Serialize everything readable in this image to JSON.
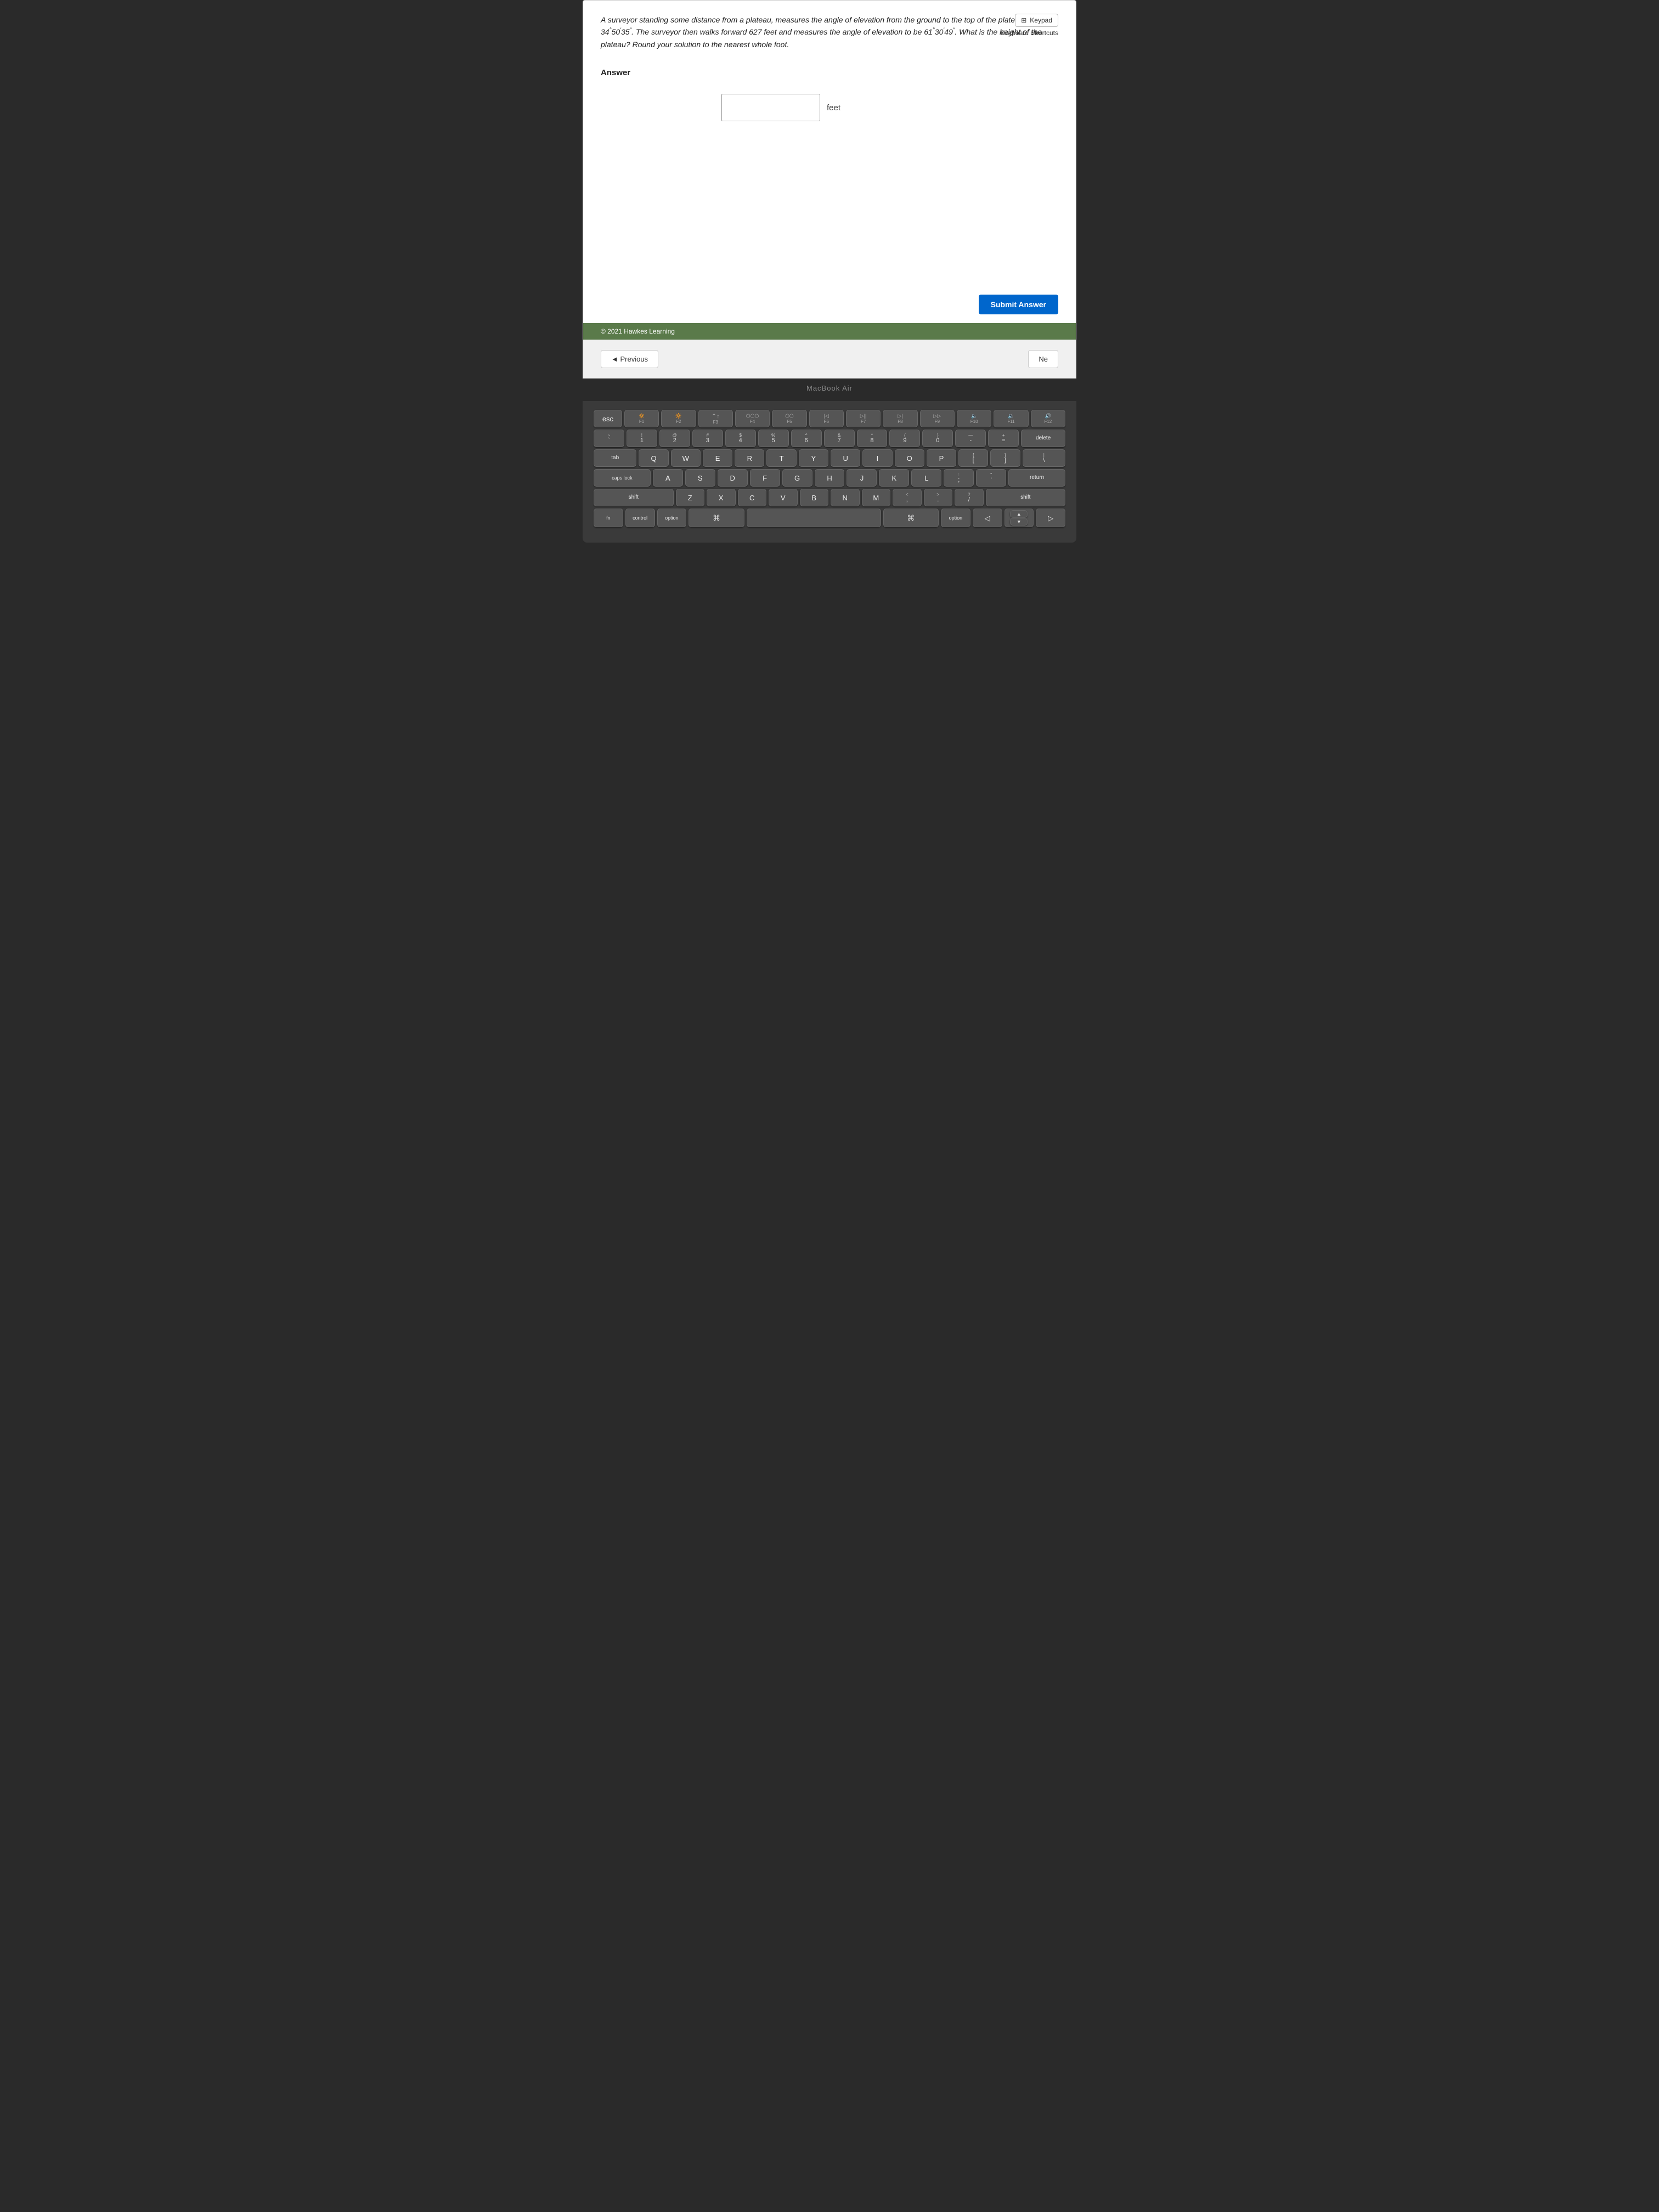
{
  "problem": {
    "text": "A surveyor standing some distance from a plateau, measures the angle of elevation from the ground to the top of the plateau to be 34°50′35″. The surveyor then walks forward 627 feet and measures the angle of elevation to be 61°30′49″. What is the height of the plateau? Round your solution to the nearest whole foot."
  },
  "answer_section": {
    "label": "Answer",
    "input_value": "",
    "input_placeholder": "",
    "unit": "feet"
  },
  "toolbar": {
    "keypad_label": "Keypad",
    "keyboard_shortcuts_label": "Keyboard Shortcuts"
  },
  "submit_button": {
    "label": "Submit Answer"
  },
  "footer": {
    "copyright": "© 2021 Hawkes Learning"
  },
  "navigation": {
    "previous_label": "◄ Previous",
    "next_label": "Ne"
  },
  "macbook_label": "MacBook Air",
  "keyboard": {
    "fn_row": [
      {
        "label": "esc",
        "sub": ""
      },
      {
        "top": "🔅",
        "sub": "F1"
      },
      {
        "top": "🔆",
        "sub": "F2"
      },
      {
        "top": "⌃↑",
        "sub": "F3"
      },
      {
        "top": "⬡⬡⬡",
        "sub": "F4"
      },
      {
        "top": "⬡⬡",
        "sub": "F5"
      },
      {
        "top": "◁◁",
        "sub": "F6"
      },
      {
        "top": "◁▷",
        "sub": "F7"
      },
      {
        "top": "▷▷",
        "sub": "F8"
      },
      {
        "top": "▷▷",
        "sub": "F9"
      },
      {
        "top": "▷▷",
        "sub": "F10"
      },
      {
        "top": "🔈",
        "sub": "F11"
      },
      {
        "top": "🔊",
        "sub": "F12"
      }
    ],
    "row1": [
      "#",
      "$4",
      "%5",
      "^6",
      "&7",
      "*8",
      "(9",
      ")0",
      "—",
      "+"
    ],
    "row2_letters": [
      "E",
      "R",
      "T",
      "Y",
      "U",
      "I",
      "O",
      "P",
      "{["
    ],
    "row3_letters": [
      "F",
      "G",
      "H",
      "J",
      "K",
      "L",
      ":;"
    ],
    "row4_letters": [
      "C",
      "V",
      "B",
      "N",
      "M",
      "<",
      ">",
      "?"
    ]
  }
}
